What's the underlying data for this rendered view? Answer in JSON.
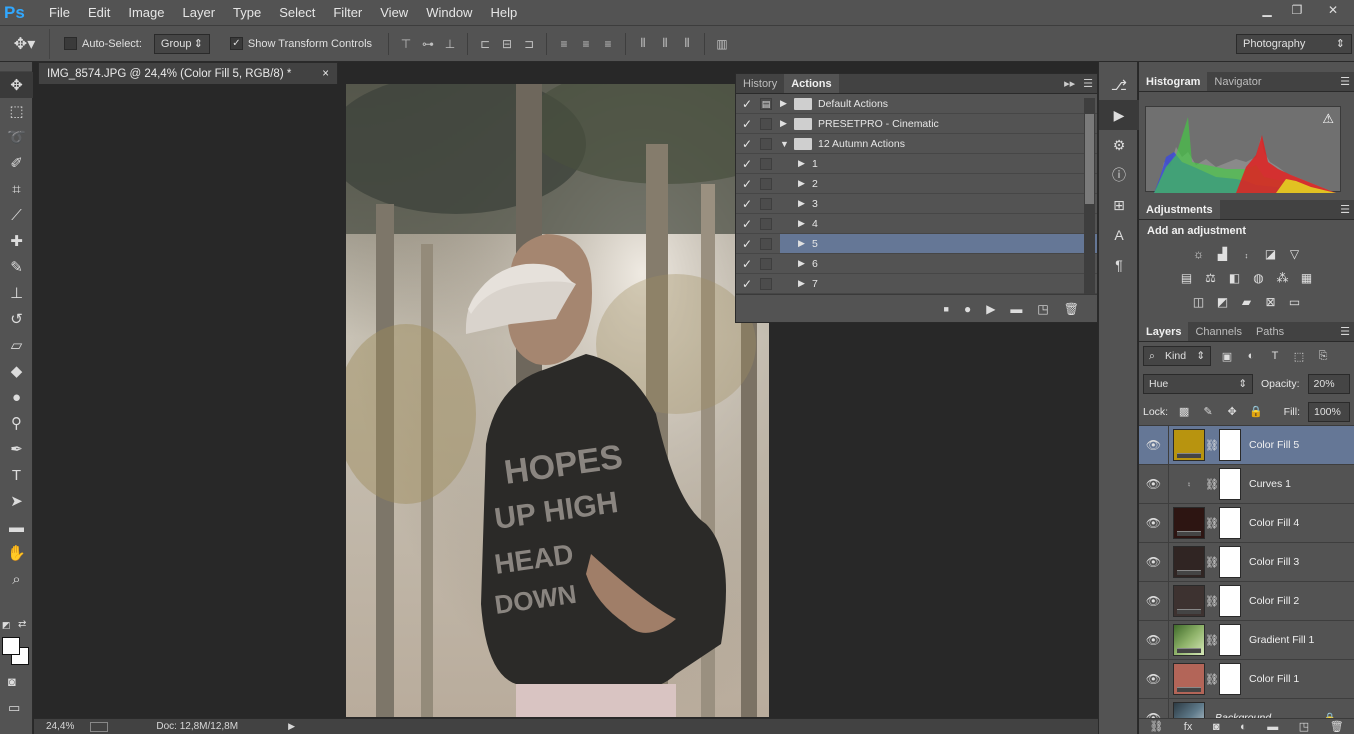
{
  "app": {
    "logo": "Ps",
    "menus": [
      "File",
      "Edit",
      "Image",
      "Layer",
      "Type",
      "Select",
      "Filter",
      "View",
      "Window",
      "Help"
    ],
    "window_controls": {
      "minimize": "▁",
      "restore": "❐",
      "close": "✕"
    }
  },
  "options_bar": {
    "auto_select_label": "Auto-Select:",
    "auto_select_checked": false,
    "auto_select_target": "Group",
    "show_transform_label": "Show Transform Controls",
    "show_transform_checked": true,
    "workspace": "Photography"
  },
  "toolbar": {
    "tools": [
      "move-icon",
      "marquee-icon",
      "lasso-icon",
      "quick-select-icon",
      "crop-icon",
      "eyedropper-icon",
      "healing-brush-icon",
      "brush-icon",
      "clone-stamp-icon",
      "history-brush-icon",
      "eraser-icon",
      "paint-bucket-icon",
      "blur-icon",
      "dodge-icon",
      "pen-icon",
      "type-icon",
      "path-select-icon",
      "rectangle-icon",
      "hand-icon",
      "zoom-icon"
    ],
    "foreground_color": "#ffffff",
    "background_color": "#ffffff"
  },
  "document": {
    "tab_title": "IMG_8574.JPG @ 24,4% (Color Fill 5, RGB/8) *",
    "close_glyph": "×",
    "zoom": "24,4%",
    "doc_info": "Doc: 12,8M/12,8M"
  },
  "actions_panel": {
    "tabs": [
      {
        "label": "History",
        "active": false
      },
      {
        "label": "Actions",
        "active": true
      }
    ],
    "rows": [
      {
        "label": "Default Actions",
        "type": "set",
        "expanded": false,
        "checked": true,
        "dialog": true,
        "selected": false
      },
      {
        "label": "PRESETPRO - Cinematic",
        "type": "set",
        "expanded": false,
        "checked": true,
        "dialog": false,
        "selected": false
      },
      {
        "label": "12 Autumn Actions",
        "type": "set",
        "expanded": true,
        "checked": true,
        "dialog": false,
        "selected": false
      },
      {
        "label": "1",
        "type": "action",
        "checked": true,
        "dialog": false,
        "selected": false
      },
      {
        "label": "2",
        "type": "action",
        "checked": true,
        "dialog": false,
        "selected": false
      },
      {
        "label": "3",
        "type": "action",
        "checked": true,
        "dialog": false,
        "selected": false
      },
      {
        "label": "4",
        "type": "action",
        "checked": true,
        "dialog": false,
        "selected": false
      },
      {
        "label": "5",
        "type": "action",
        "checked": true,
        "dialog": false,
        "selected": true
      },
      {
        "label": "6",
        "type": "action",
        "checked": true,
        "dialog": false,
        "selected": false
      },
      {
        "label": "7",
        "type": "action",
        "checked": true,
        "dialog": false,
        "selected": false
      }
    ],
    "bottom_buttons": [
      "stop-icon",
      "record-icon",
      "play-icon",
      "new-set-icon",
      "new-action-icon",
      "delete-icon"
    ]
  },
  "histogram_panel": {
    "tabs": [
      {
        "label": "Histogram",
        "active": true
      },
      {
        "label": "Navigator",
        "active": false
      }
    ],
    "warning_glyph": "⚠"
  },
  "adjustments_panel": {
    "tab": "Adjustments",
    "title": "Add an adjustment"
  },
  "layers_panel": {
    "tabs": [
      {
        "label": "Layers",
        "active": true
      },
      {
        "label": "Channels",
        "active": false
      },
      {
        "label": "Paths",
        "active": false
      }
    ],
    "filter_kind": "Kind",
    "blend_mode": "Hue",
    "opacity_label": "Opacity:",
    "opacity": "20%",
    "lock_label": "Lock:",
    "fill_label": "Fill:",
    "fill": "100%",
    "layers": [
      {
        "name": "Color Fill 5",
        "thumb_color": "#b8940f",
        "kind": "fill",
        "selected": true
      },
      {
        "name": "Curves 1",
        "thumb_color": "#535353",
        "kind": "curves",
        "selected": false
      },
      {
        "name": "Color Fill 4",
        "thumb_color": "#2d1512",
        "kind": "fill",
        "selected": false
      },
      {
        "name": "Color Fill 3",
        "thumb_color": "#302523",
        "kind": "fill",
        "selected": false
      },
      {
        "name": "Color Fill 2",
        "thumb_color": "#3d3230",
        "kind": "fill",
        "selected": false
      },
      {
        "name": "Gradient Fill 1",
        "thumb_color": "#8fb36a",
        "kind": "gradient",
        "selected": false
      },
      {
        "name": "Color Fill 1",
        "thumb_color": "#b36558",
        "kind": "fill",
        "selected": false
      },
      {
        "name": "Background",
        "thumb_color": "#5f7a8a",
        "kind": "image",
        "selected": false
      }
    ]
  }
}
